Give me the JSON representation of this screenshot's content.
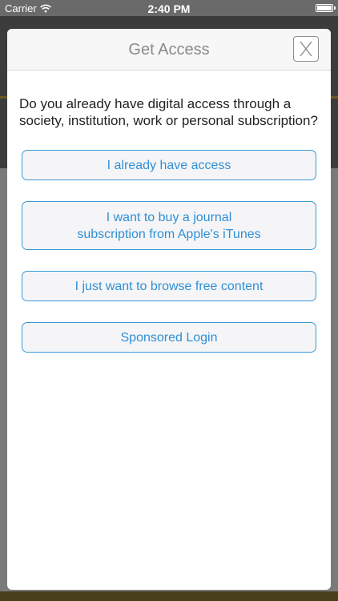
{
  "status_bar": {
    "carrier": "Carrier",
    "time": "2:40 PM",
    "wifi_icon": "wifi-icon",
    "battery_icon": "battery-icon"
  },
  "modal": {
    "title": "Get Access",
    "close_label": "X",
    "question": "Do you already have digital access through a society, institution, work or personal subscription?",
    "options": [
      {
        "label": "I already have access"
      },
      {
        "label_line1": "I want to buy a journal",
        "label_line2": "subscription from Apple's iTunes"
      },
      {
        "label": "I just want to browse free content"
      },
      {
        "label": "Sponsored Login"
      }
    ]
  },
  "colors": {
    "accent": "#2f90d6",
    "button_border": "#3a9ad9",
    "title_gray": "#8a8a8a"
  }
}
